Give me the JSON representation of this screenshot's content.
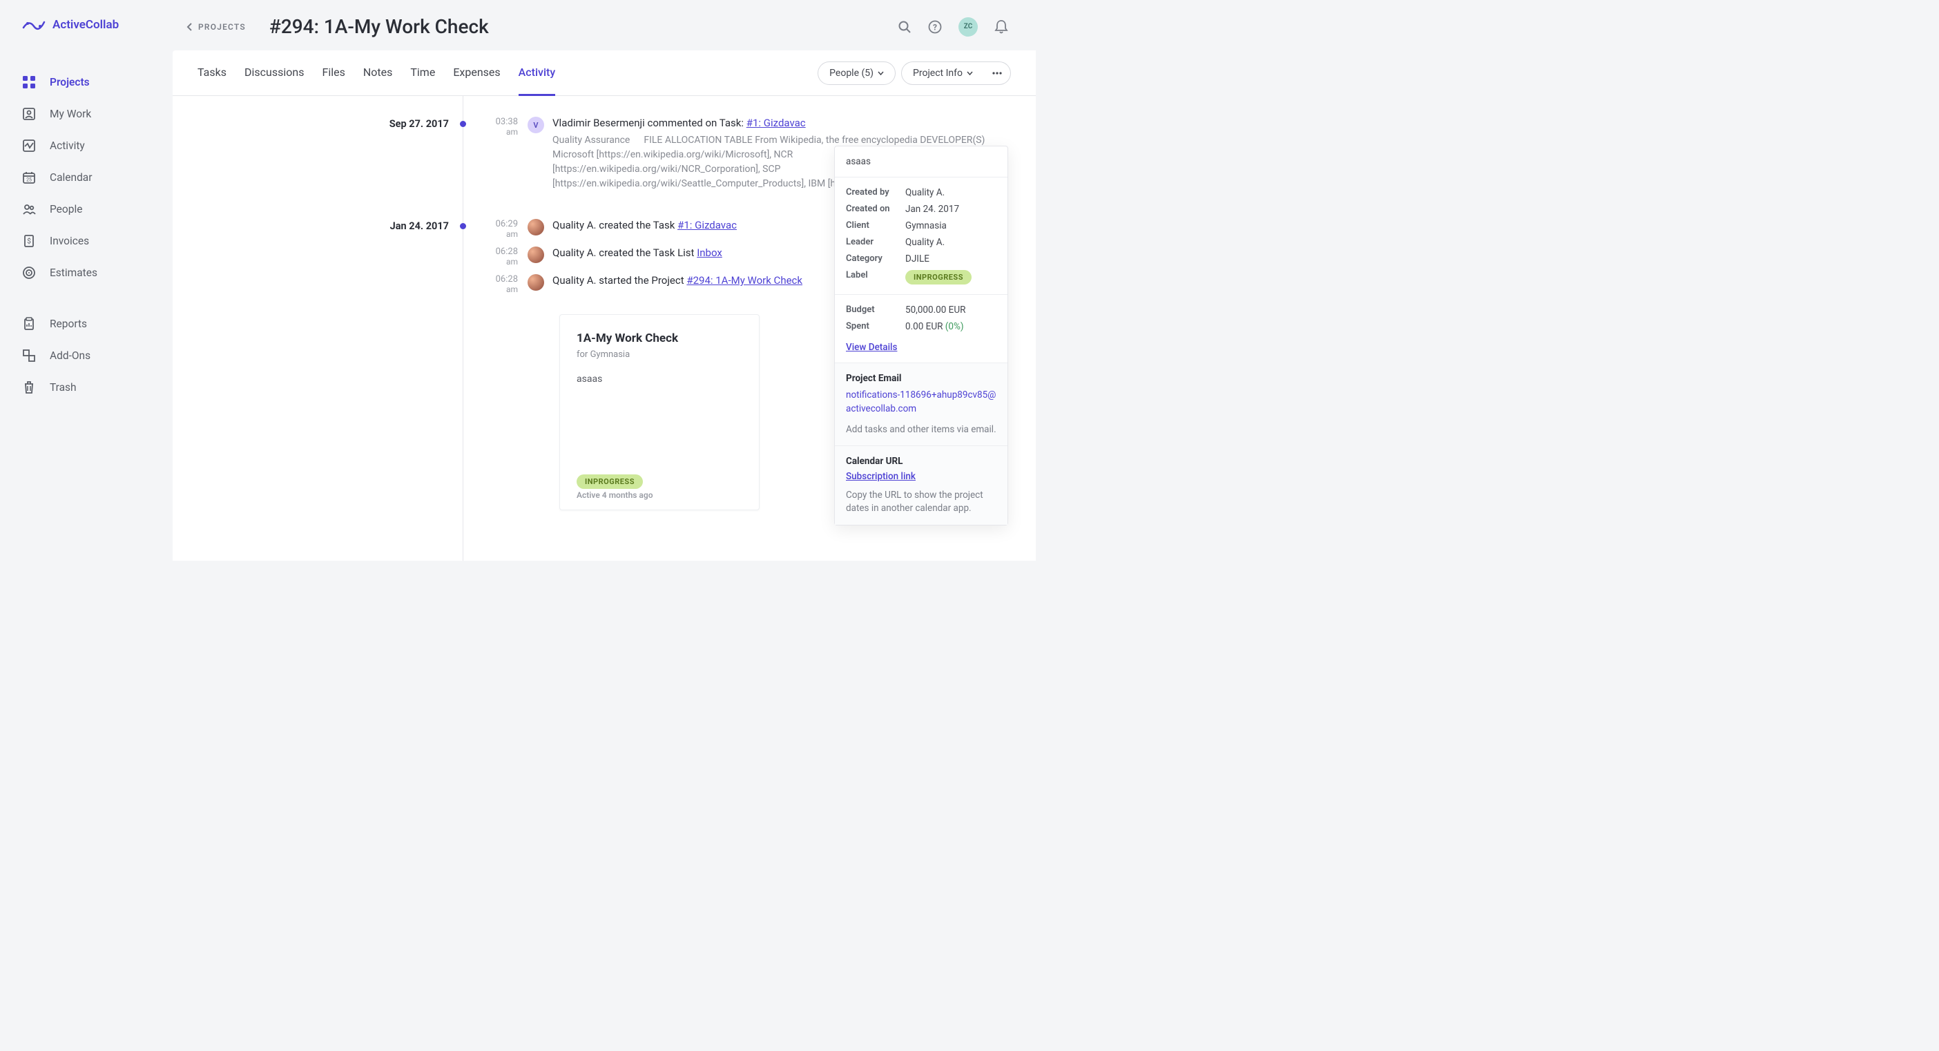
{
  "brand": "ActiveCollab",
  "breadcrumb": "PROJECTS",
  "page_title": "#294: 1A-My Work Check",
  "user_initials": "ZC",
  "nav": [
    {
      "label": "Projects",
      "icon": "projects"
    },
    {
      "label": "My Work",
      "icon": "mywork"
    },
    {
      "label": "Activity",
      "icon": "activity"
    },
    {
      "label": "Calendar",
      "icon": "calendar"
    },
    {
      "label": "People",
      "icon": "people"
    },
    {
      "label": "Invoices",
      "icon": "invoices"
    },
    {
      "label": "Estimates",
      "icon": "estimates"
    },
    {
      "label": "Reports",
      "icon": "reports"
    },
    {
      "label": "Add-Ons",
      "icon": "addons"
    },
    {
      "label": "Trash",
      "icon": "trash"
    }
  ],
  "tabs": [
    "Tasks",
    "Discussions",
    "Files",
    "Notes",
    "Time",
    "Expenses",
    "Activity"
  ],
  "active_tab": "Activity",
  "people_btn": "People (5)",
  "projectinfo_btn": "Project Info",
  "timeline": [
    {
      "date": "Sep 27. 2017",
      "events": [
        {
          "time": "03:38",
          "ampm": "am",
          "avatar": "v",
          "avatar_letter": "V",
          "text_prefix": "Vladimir Besermenji commented on Task: ",
          "link": "#1: Gizdavac",
          "sub_qa": "Quality Assurance",
          "sub_body": "FILE ALLOCATION TABLE From Wikipedia, the free encyclopedia    DEVELOPER(S) Microsoft [https://en.wikipedia.org/wiki/Microsoft], NCR [https://en.wikipedia.org/wiki/NCR_Corporation], SCP [https://en.wikipedia.org/wiki/Seattle_Computer_Products], IBM [https://en…"
        }
      ]
    },
    {
      "date": "Jan 24. 2017",
      "events": [
        {
          "time": "06:29",
          "ampm": "am",
          "avatar": "q",
          "text_prefix": "Quality A. created the Task ",
          "link": "#1: Gizdavac"
        },
        {
          "time": "06:28",
          "ampm": "am",
          "avatar": "q",
          "text_prefix": "Quality A. created the Task List ",
          "link": "Inbox"
        },
        {
          "time": "06:28",
          "ampm": "am",
          "avatar": "q",
          "text_prefix": "Quality A. started the Project ",
          "link": "#294: 1A-My Work Check"
        }
      ]
    }
  ],
  "project_card": {
    "title": "1A-My Work Check",
    "for": "for Gymnasia",
    "desc": "asaas",
    "label": "INPROGRESS",
    "active": "Active 4 months ago"
  },
  "info": {
    "desc": "asaas",
    "created_by_k": "Created by",
    "created_by_v": "Quality A.",
    "created_on_k": "Created on",
    "created_on_v": "Jan 24. 2017",
    "client_k": "Client",
    "client_v": "Gymnasia",
    "leader_k": "Leader",
    "leader_v": "Quality A.",
    "category_k": "Category",
    "category_v": "DJILE",
    "label_k": "Label",
    "label_v": "INPROGRESS",
    "budget_k": "Budget",
    "budget_v": "50,000.00 EUR",
    "spent_k": "Spent",
    "spent_v": "0.00 EUR ",
    "spent_pct": "(0%)",
    "view_details": "View Details",
    "email_h": "Project Email",
    "email": "notifications-118696+ahup89cv85@activecollab.com",
    "email_hint": "Add tasks and other items via email.",
    "cal_h": "Calendar URL",
    "cal_link": "Subscription link",
    "cal_hint": "Copy the URL to show the project dates in another calendar app."
  }
}
